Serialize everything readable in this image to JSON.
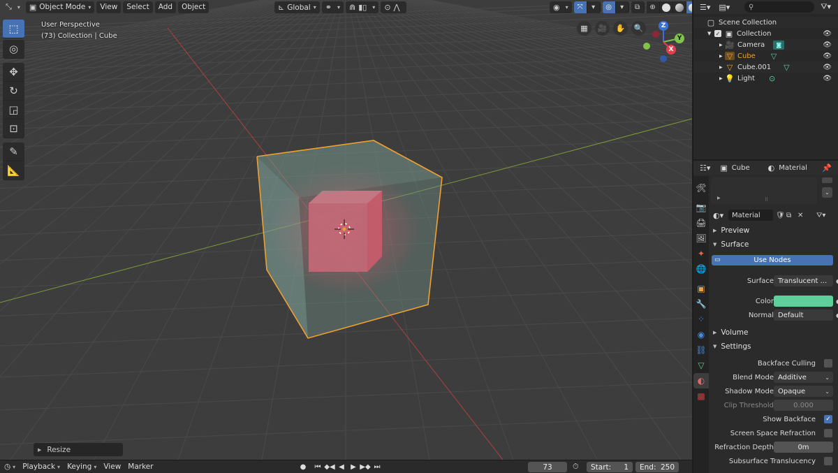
{
  "header": {
    "mode": "Object Mode",
    "menus": [
      "View",
      "Select",
      "Add",
      "Object"
    ],
    "transform_orientation": "Global"
  },
  "viewport": {
    "perspective": "User Perspective",
    "context": "(73) Collection | Cube",
    "gizmo": {
      "z": "Z",
      "y": "Y",
      "x": "X"
    },
    "last_op": "Resize"
  },
  "timeline": {
    "menus": [
      "Playback",
      "Keying",
      "View",
      "Marker"
    ],
    "frame": "73",
    "start_label": "Start:",
    "start": "1",
    "end_label": "End:",
    "end": "250"
  },
  "outliner": {
    "root": "Scene Collection",
    "collection": "Collection",
    "items": [
      {
        "name": "Camera",
        "color": "#e0e0e0",
        "icon": "camera-icon"
      },
      {
        "name": "Cube",
        "color": "#f0a030",
        "icon": "mesh-icon"
      },
      {
        "name": "Cube.001",
        "color": "#e0e0e0",
        "icon": "mesh-icon"
      },
      {
        "name": "Light",
        "color": "#e0e0e0",
        "icon": "light-icon"
      }
    ]
  },
  "properties": {
    "object": "Cube",
    "tab": "Material",
    "material_name": "Material",
    "preview": "Preview",
    "surface_section": "Surface",
    "use_nodes": "Use Nodes",
    "surface_label": "Surface",
    "surface_value": "Translucent ...",
    "color_label": "Color",
    "color_value": "#5ecf9a",
    "normal_label": "Normal",
    "normal_value": "Default",
    "volume_section": "Volume",
    "settings_section": "Settings",
    "backface_culling": "Backface Culling",
    "blend_mode_label": "Blend Mode",
    "blend_mode_value": "Additive",
    "shadow_mode_label": "Shadow Mode",
    "shadow_mode_value": "Opaque",
    "clip_threshold_label": "Clip Threshold",
    "clip_threshold_value": "0.000",
    "show_backface": "Show Backface",
    "ssr": "Screen Space Refraction",
    "refraction_depth_label": "Refraction Depth",
    "refraction_depth_value": "0m",
    "subsurface": "Subsurface Translucency"
  }
}
